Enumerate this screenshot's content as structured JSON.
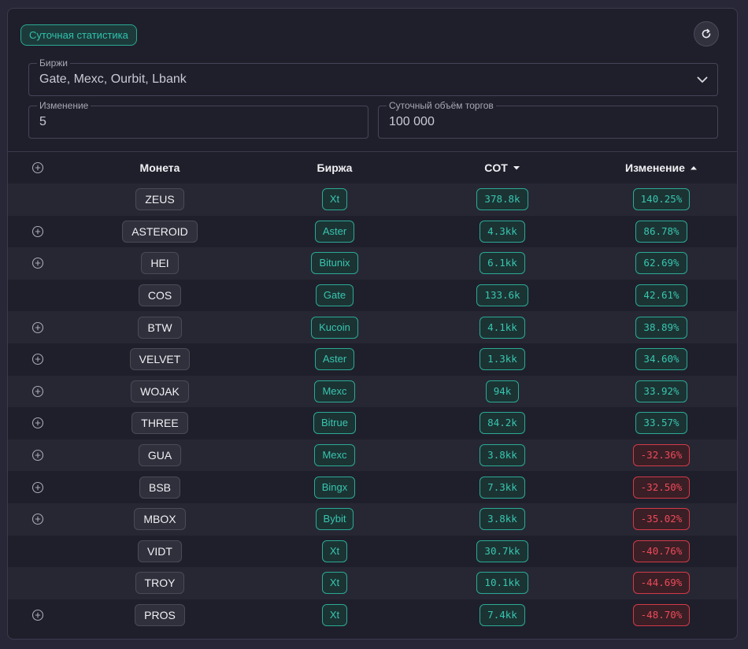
{
  "header": {
    "title": "Суточная статистика",
    "refresh_icon": "refresh-icon"
  },
  "filters": {
    "exchanges": {
      "label": "Биржи",
      "value": "Gate, Mexc, Ourbit, Lbank"
    },
    "change": {
      "label": "Изменение",
      "value": "5"
    },
    "volume": {
      "label": "Суточный объём торгов",
      "value": "100 000"
    }
  },
  "table": {
    "columns": {
      "coin": "Монета",
      "exchange": "Биржа",
      "cot": "COT",
      "change": "Изменение"
    },
    "sort": {
      "cot": "desc",
      "change": "asc"
    },
    "rows": [
      {
        "plus": false,
        "coin": "ZEUS",
        "exchange": "Xt",
        "cot": "378.8k",
        "change": "140.25%",
        "status": "up"
      },
      {
        "plus": true,
        "coin": "ASTEROID",
        "exchange": "Aster",
        "cot": "4.3kk",
        "change": "86.78%",
        "status": "up"
      },
      {
        "plus": true,
        "coin": "HEI",
        "exchange": "Bitunix",
        "cot": "6.1kk",
        "change": "62.69%",
        "status": "up"
      },
      {
        "plus": false,
        "coin": "COS",
        "exchange": "Gate",
        "cot": "133.6k",
        "change": "42.61%",
        "status": "up"
      },
      {
        "plus": true,
        "coin": "BTW",
        "exchange": "Kucoin",
        "cot": "4.1kk",
        "change": "38.89%",
        "status": "up"
      },
      {
        "plus": true,
        "coin": "VELVET",
        "exchange": "Aster",
        "cot": "1.3kk",
        "change": "34.60%",
        "status": "up"
      },
      {
        "plus": true,
        "coin": "WOJAK",
        "exchange": "Mexc",
        "cot": "94k",
        "change": "33.92%",
        "status": "up"
      },
      {
        "plus": true,
        "coin": "THREE",
        "exchange": "Bitrue",
        "cot": "84.2k",
        "change": "33.57%",
        "status": "up"
      },
      {
        "plus": true,
        "coin": "GUA",
        "exchange": "Mexc",
        "cot": "3.8kk",
        "change": "-32.36%",
        "status": "down"
      },
      {
        "plus": true,
        "coin": "BSB",
        "exchange": "Bingx",
        "cot": "7.3kk",
        "change": "-32.50%",
        "status": "down"
      },
      {
        "plus": true,
        "coin": "MBOX",
        "exchange": "Bybit",
        "cot": "3.8kk",
        "change": "-35.02%",
        "status": "down"
      },
      {
        "plus": false,
        "coin": "VIDT",
        "exchange": "Xt",
        "cot": "30.7kk",
        "change": "-40.76%",
        "status": "down"
      },
      {
        "plus": false,
        "coin": "TROY",
        "exchange": "Xt",
        "cot": "10.1kk",
        "change": "-44.69%",
        "status": "down"
      },
      {
        "plus": true,
        "coin": "PROS",
        "exchange": "Xt",
        "cot": "7.4kk",
        "change": "-48.70%",
        "status": "down"
      }
    ]
  },
  "colors": {
    "accent": "#2fc2ad",
    "negative": "#ef4a58",
    "background": "#1f1f2b"
  }
}
